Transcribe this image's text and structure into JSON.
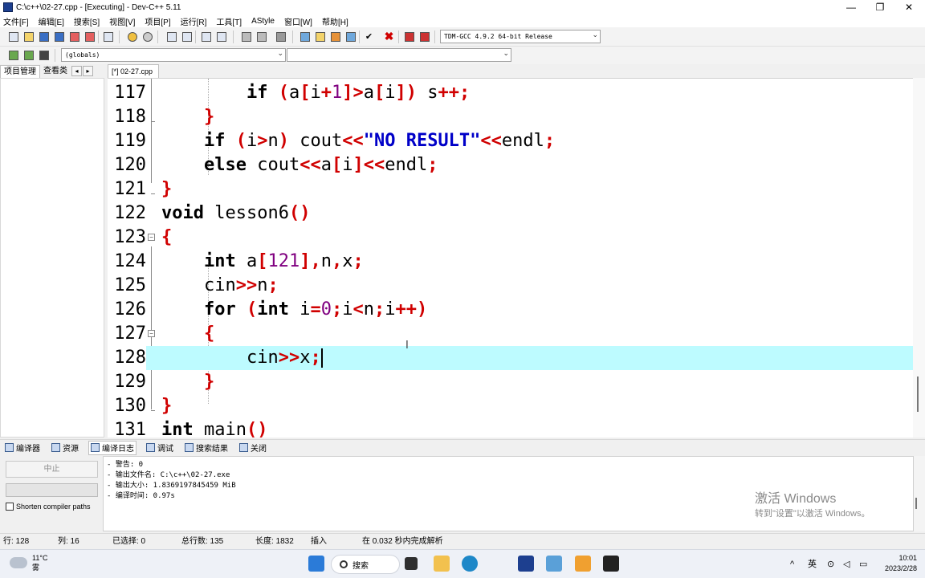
{
  "window": {
    "title": "C:\\c++\\02-27.cpp - [Executing] - Dev-C++ 5.11",
    "controls": [
      "—",
      "❐",
      "✕"
    ]
  },
  "menu": [
    "文件[F]",
    "编辑[E]",
    "搜索[S]",
    "视图[V]",
    "项目[P]",
    "运行[R]",
    "工具[T]",
    "AStyle",
    "窗口[W]",
    "帮助[H]"
  ],
  "toolbar": {
    "compiler": "TDM-GCC 4.9.2 64-bit Release",
    "scope": "(globals)",
    "member": ""
  },
  "left_tabs": [
    "项目管理",
    "查看类"
  ],
  "file_tab": "[*] 02-27.cpp",
  "editor": {
    "lines": [
      {
        "n": "117",
        "tokens": [
          [
            "        ",
            ""
          ],
          [
            "if",
            "kw"
          ],
          [
            " ",
            ""
          ],
          [
            "(",
            "op"
          ],
          [
            "a",
            ""
          ],
          [
            "[",
            "op"
          ],
          [
            "i",
            ""
          ],
          [
            "+",
            "op"
          ],
          [
            "1",
            "num"
          ],
          [
            "]>",
            "op"
          ],
          [
            "a",
            ""
          ],
          [
            "[",
            "op"
          ],
          [
            "i",
            ""
          ],
          [
            "])",
            "op"
          ],
          [
            " s",
            ""
          ],
          [
            "++;",
            "op"
          ]
        ]
      },
      {
        "n": "118",
        "tokens": [
          [
            "    ",
            ""
          ],
          [
            "}",
            "op"
          ]
        ]
      },
      {
        "n": "119",
        "tokens": [
          [
            "    ",
            ""
          ],
          [
            "if",
            "kw"
          ],
          [
            " ",
            ""
          ],
          [
            "(",
            "op"
          ],
          [
            "i",
            ""
          ],
          [
            ">",
            "op"
          ],
          [
            "n",
            ""
          ],
          [
            ")",
            "op"
          ],
          [
            " cout",
            ""
          ],
          [
            "<<",
            "op"
          ],
          [
            "\"NO RESULT\"",
            "str"
          ],
          [
            "<<",
            "op"
          ],
          [
            "endl",
            ""
          ],
          [
            ";",
            "op"
          ]
        ]
      },
      {
        "n": "120",
        "tokens": [
          [
            "    ",
            ""
          ],
          [
            "else",
            "kw"
          ],
          [
            " cout",
            ""
          ],
          [
            "<<",
            "op"
          ],
          [
            "a",
            ""
          ],
          [
            "[",
            "op"
          ],
          [
            "i",
            ""
          ],
          [
            "]<<",
            "op"
          ],
          [
            "endl",
            ""
          ],
          [
            ";",
            "op"
          ]
        ]
      },
      {
        "n": "121",
        "tokens": [
          [
            "}",
            "op"
          ]
        ]
      },
      {
        "n": "122",
        "tokens": [
          [
            "void",
            "kw"
          ],
          [
            " lesson6",
            ""
          ],
          [
            "()",
            "op"
          ]
        ]
      },
      {
        "n": "123",
        "tokens": [
          [
            "{",
            "op"
          ]
        ]
      },
      {
        "n": "124",
        "tokens": [
          [
            "    ",
            ""
          ],
          [
            "int",
            "kw"
          ],
          [
            " a",
            ""
          ],
          [
            "[",
            "op"
          ],
          [
            "121",
            "num"
          ],
          [
            "],",
            "op"
          ],
          [
            "n",
            ""
          ],
          [
            ",",
            "op"
          ],
          [
            "x",
            ""
          ],
          [
            ";",
            "op"
          ]
        ]
      },
      {
        "n": "125",
        "tokens": [
          [
            "    cin",
            ""
          ],
          [
            ">>",
            "op"
          ],
          [
            "n",
            ""
          ],
          [
            ";",
            "op"
          ]
        ]
      },
      {
        "n": "126",
        "tokens": [
          [
            "    ",
            ""
          ],
          [
            "for",
            "kw"
          ],
          [
            " ",
            ""
          ],
          [
            "(",
            "op"
          ],
          [
            "int",
            "kw"
          ],
          [
            " i",
            ""
          ],
          [
            "=",
            "op"
          ],
          [
            "0",
            "num"
          ],
          [
            ";",
            "op"
          ],
          [
            "i",
            ""
          ],
          [
            "<",
            "op"
          ],
          [
            "n",
            ""
          ],
          [
            ";",
            "op"
          ],
          [
            "i",
            ""
          ],
          [
            "++)",
            "op"
          ]
        ]
      },
      {
        "n": "127",
        "tokens": [
          [
            "    ",
            ""
          ],
          [
            "{",
            "op"
          ]
        ]
      },
      {
        "n": "128",
        "tokens": [
          [
            "        cin",
            ""
          ],
          [
            ">>",
            "op"
          ],
          [
            "x",
            ""
          ],
          [
            ";",
            "op"
          ]
        ],
        "active": true
      },
      {
        "n": "129",
        "tokens": [
          [
            "    ",
            ""
          ],
          [
            "}",
            "op"
          ]
        ]
      },
      {
        "n": "130",
        "tokens": [
          [
            "}",
            "op"
          ]
        ]
      },
      {
        "n": "131",
        "tokens": [
          [
            "int",
            "kw"
          ],
          [
            " main",
            ""
          ],
          [
            "()",
            "op"
          ]
        ]
      }
    ]
  },
  "bottom_tabs": [
    "编译器",
    "资源",
    "编译日志",
    "调试",
    "搜索结果",
    "关闭"
  ],
  "bottom_left": {
    "stop_button": "中止",
    "checkbox_label": "Shorten compiler paths"
  },
  "compile_log": [
    "- 警告: 0",
    "- 输出文件名: C:\\c++\\02-27.exe",
    "- 输出大小: 1.8369197845459 MiB",
    "- 编译时间: 0.97s"
  ],
  "watermark": {
    "line1": "激活 Windows",
    "line2": "转到\"设置\"以激活 Windows。"
  },
  "status": {
    "row": "行: 128",
    "col": "列: 16",
    "selected": "已选择: 0",
    "total_lines": "总行数: 135",
    "length": "长度: 1832",
    "mode": "插入",
    "parse": "在 0.032 秒内完成解析"
  },
  "taskbar": {
    "temperature": "11°C",
    "weather": "雾",
    "search": "搜索",
    "ime": "英",
    "time": "10:01",
    "date": "2023/2/28"
  }
}
